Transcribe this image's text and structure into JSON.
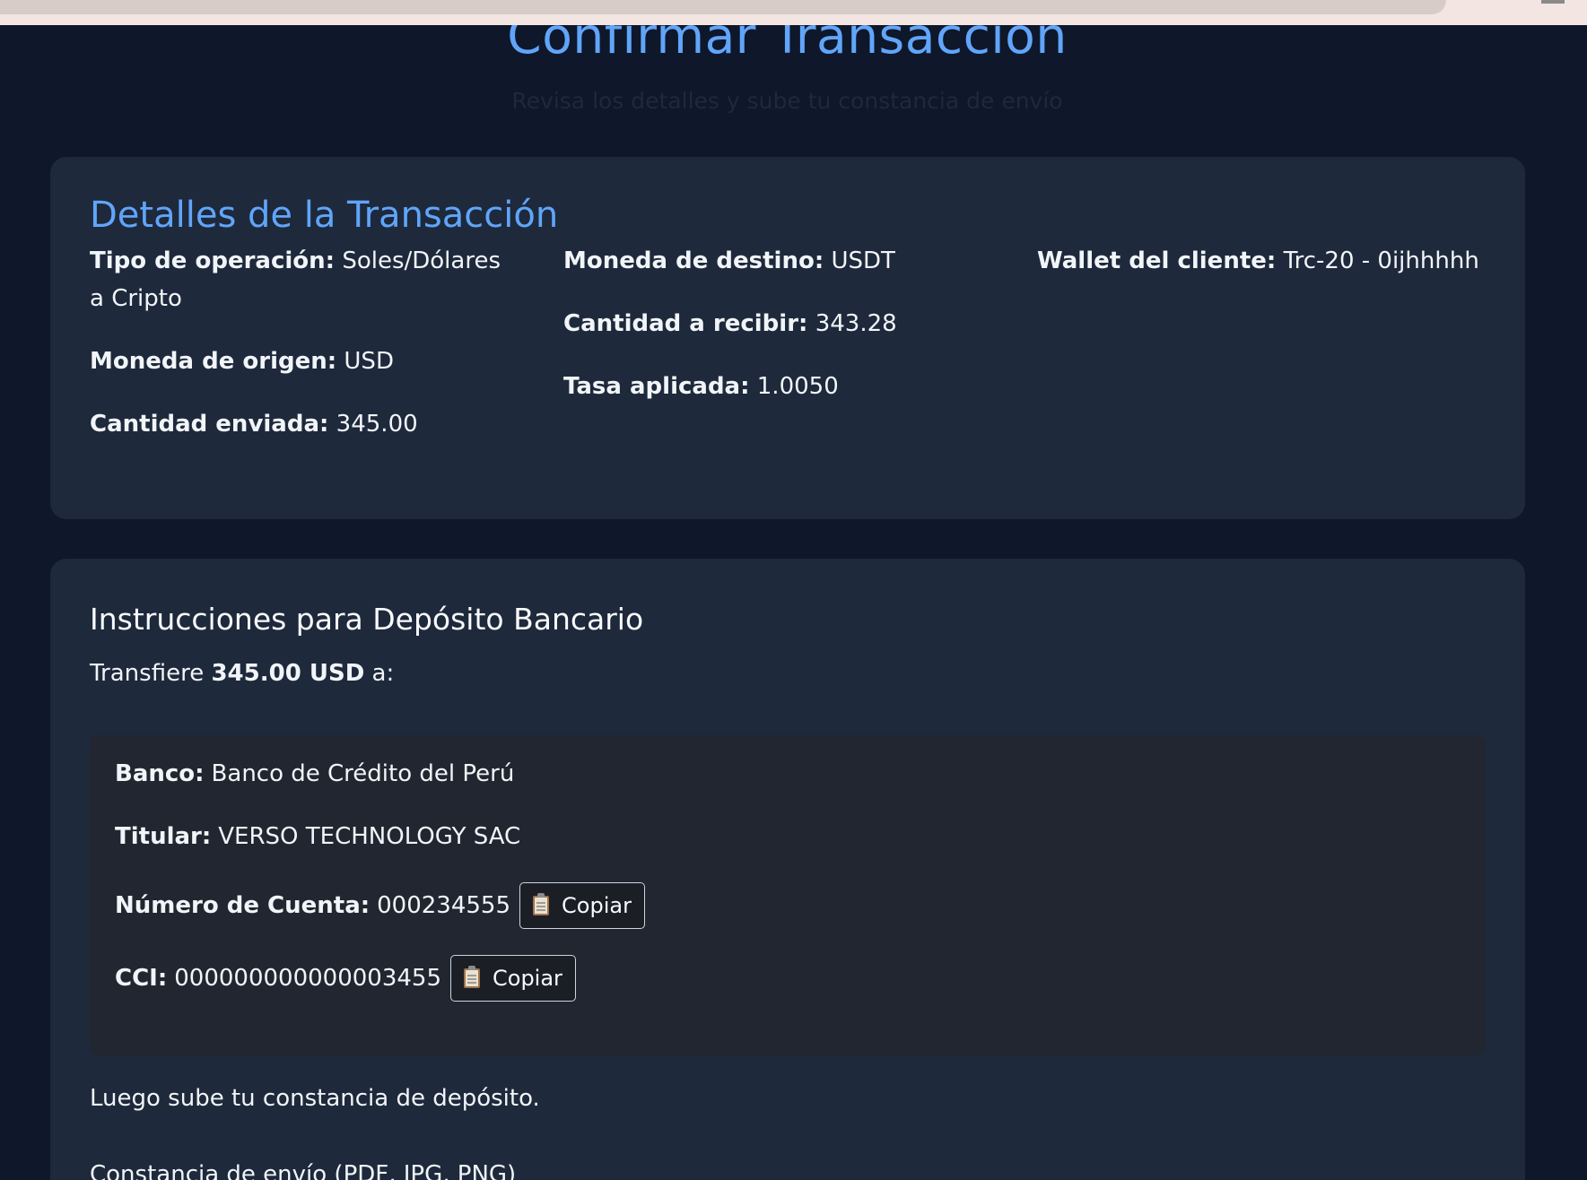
{
  "page": {
    "title": "Confirmar Transacción",
    "subtitle": "Revisa los detalles y sube tu constancia de envío"
  },
  "details": {
    "heading": "Detalles de la Transacción",
    "tipo_operacion": {
      "label": "Tipo de operación:",
      "value": "Soles/Dólares a Cripto"
    },
    "moneda_origen": {
      "label": "Moneda de origen:",
      "value": "USD"
    },
    "cantidad_enviada": {
      "label": "Cantidad enviada:",
      "value": "345.00"
    },
    "moneda_destino": {
      "label": "Moneda de destino:",
      "value": "USDT"
    },
    "cantidad_recibir": {
      "label": "Cantidad a recibir:",
      "value": "343.28"
    },
    "tasa_aplicada": {
      "label": "Tasa aplicada:",
      "value": "1.0050"
    },
    "wallet_cliente": {
      "label": "Wallet del cliente:",
      "value": "Trc-20 - 0ijhhhhh"
    }
  },
  "bank": {
    "heading": "Instrucciones para Depósito Bancario",
    "intro_prefix": "Transfiere",
    "intro_amount": "345.00 USD",
    "intro_suffix": "a:",
    "banco": {
      "label": "Banco:",
      "value": "Banco de Crédito del Perú"
    },
    "titular": {
      "label": "Titular:",
      "value": "VERSO TECHNOLOGY SAC"
    },
    "numero_cuenta": {
      "label": "Número de Cuenta:",
      "value": "000234555"
    },
    "cci": {
      "label": "CCI:",
      "value": "000000000000003455"
    },
    "copy_label": "Copiar",
    "copy_icon": "clipboard-icon",
    "outro": "Luego sube tu constancia de depósito.",
    "upload_label": "Constancia de envío (PDF, JPG, PNG)"
  },
  "colors": {
    "background": "#0f172a",
    "card": "#1e293b",
    "accent": "#60a5fa",
    "bank_box": "#222630"
  }
}
